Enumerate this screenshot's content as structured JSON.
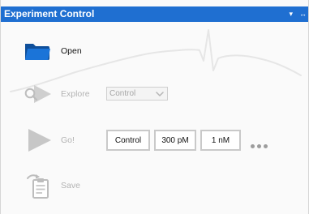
{
  "window": {
    "title": "Experiment Control",
    "dropdown_glyph": "▾",
    "pin_glyph": "↔"
  },
  "actions": {
    "open": {
      "label": "Open",
      "enabled": true,
      "icon": "folder-icon"
    },
    "explore": {
      "label": "Explore",
      "enabled": false,
      "icon": "search-play-icon",
      "select": {
        "value": "Control"
      }
    },
    "go": {
      "label": "Go!",
      "enabled": false,
      "icon": "play-icon",
      "buttons": [
        "Control",
        "300 pM",
        "1 nM"
      ],
      "more_icon": "ellipsis-icon"
    },
    "save": {
      "label": "Save",
      "enabled": false,
      "icon": "save-clipboard-icon"
    }
  }
}
